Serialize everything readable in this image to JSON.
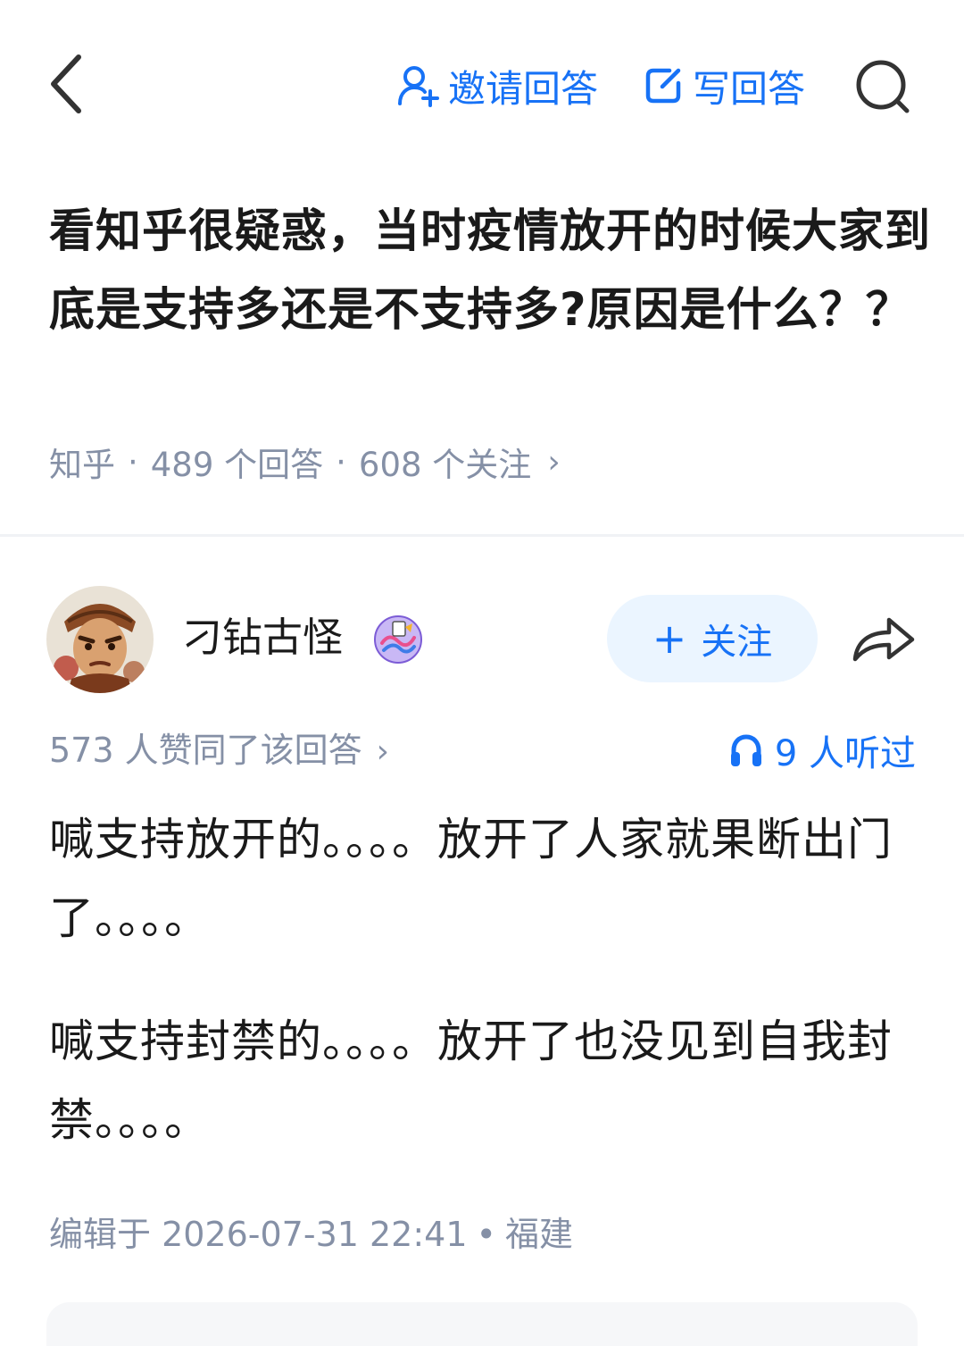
{
  "header": {
    "invite_label": "邀请回答",
    "write_label": "写回答",
    "icons": [
      "back-arrow-icon",
      "invite-user-icon",
      "write-edit-icon",
      "search-icon"
    ]
  },
  "question": {
    "title": "看知乎很疑惑，当时疫情放开的时候大家到底是支持多还是不支持多?原因是什么？？",
    "source": "知乎",
    "answers": "489 个回答",
    "followers": "608 个关注",
    "separator": "·",
    "chevron": "›"
  },
  "author": {
    "name": "刁钻古怪",
    "follow_label": "关注",
    "follow_plus": "+",
    "icons": [
      "avatar",
      "creator-badge-icon",
      "share-icon"
    ]
  },
  "answer": {
    "votes": "573 人赞同了该回答",
    "listen": "9 人听过",
    "paragraphs": [
      "喊支持放开的。。。。放开了人家就果断出门了。。。。",
      "喊支持封禁的。。。。放开了也没见到自我封禁。。。。"
    ],
    "edited": "编辑于 2026-07-31 22:41",
    "location": "福建",
    "separator": "•"
  },
  "colors": {
    "accent": "#1772f6",
    "muted": "#8590a6",
    "text": "#1a1a1a",
    "follow_bg": "#ebf5ff"
  }
}
